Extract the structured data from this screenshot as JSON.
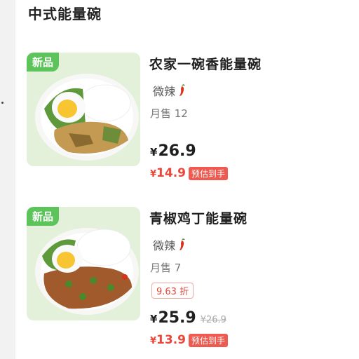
{
  "section": {
    "title": "中式能量碗"
  },
  "colors": {
    "accent_red": "#e8473a",
    "new_badge_green": "#5cc45a"
  },
  "products": [
    {
      "badge": "新品",
      "name": "农家一碗香能量碗",
      "spice": "微辣",
      "spice_icon": "chili-icon",
      "sales": "月售 12",
      "currency": "¥",
      "price": "26.9",
      "final_price": "14.9",
      "est_label": "预估到手"
    },
    {
      "badge": "新品",
      "name": "青椒鸡丁能量碗",
      "spice": "微辣",
      "spice_icon": "chili-icon",
      "sales": "月售 7",
      "discount": "9.63 折",
      "currency": "¥",
      "price": "25.9",
      "original_price": "¥26.9",
      "final_price": "13.9",
      "est_label": "预估到手"
    }
  ]
}
